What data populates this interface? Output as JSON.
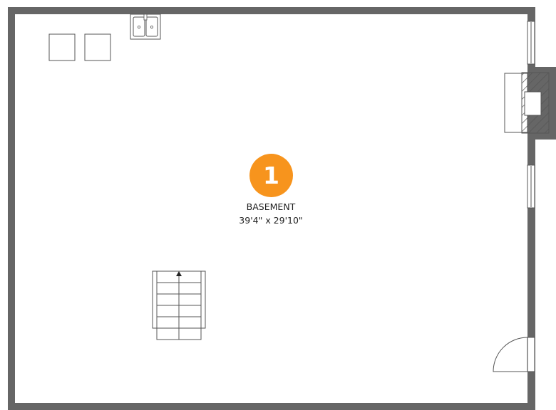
{
  "room": {
    "number": "1",
    "name": "BASEMENT",
    "dimensions": "39'4\" x 29'10\""
  },
  "colors": {
    "wall": "#666666",
    "badge": "#f7941d",
    "fixture_stroke": "#555555",
    "text": "#222222"
  },
  "icons": {
    "stairs_direction": "arrow-up-icon"
  }
}
